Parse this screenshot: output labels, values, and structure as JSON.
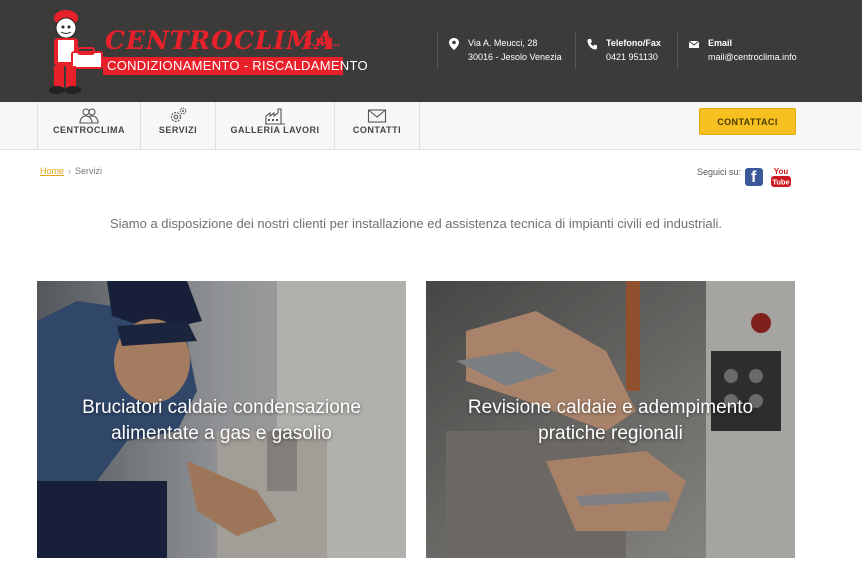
{
  "brand": {
    "name": "CENTROCLIMA",
    "suffix": "S.R.L.",
    "tagline": "CONDIZIONAMENTO - RISCALDAMENTO",
    "color": "#e8202a"
  },
  "contacts": [
    {
      "icon": "map-pin-icon",
      "title": "",
      "lines": [
        "Via A. Meucci, 28",
        "30016 - Jesolo Venezia"
      ]
    },
    {
      "icon": "phone-icon",
      "title": "Telefono/Fax",
      "lines": [
        "0421 951130"
      ]
    },
    {
      "icon": "mail-icon",
      "title": "Email",
      "lines": [
        "mail@centroclima.info"
      ]
    }
  ],
  "nav": {
    "items": [
      {
        "label": "CENTROCLIMA",
        "icon": "people-icon"
      },
      {
        "label": "SERVIZI",
        "icon": "gears-icon"
      },
      {
        "label": "GALLERIA LAVORI",
        "icon": "factory-icon"
      },
      {
        "label": "CONTATTI",
        "icon": "envelope-icon"
      }
    ],
    "cta_label": "CONTATTACI",
    "cta_color": "#f6c120"
  },
  "breadcrumb": {
    "home": "Home",
    "current": "Servizi"
  },
  "social": {
    "label": "Seguici su:",
    "facebook_glyph": "f",
    "youtube_top": "You",
    "youtube_bottom": "Tube"
  },
  "intro": "Siamo a disposizione dei nostri clienti per installazione ed assistenza tecnica di impianti civili ed industriali.",
  "cards": [
    {
      "title": "Bruciatori caldaie condensazione alimentate a gas e gasolio"
    },
    {
      "title": "Revisione caldaie e adempimento pratiche regionali"
    }
  ]
}
